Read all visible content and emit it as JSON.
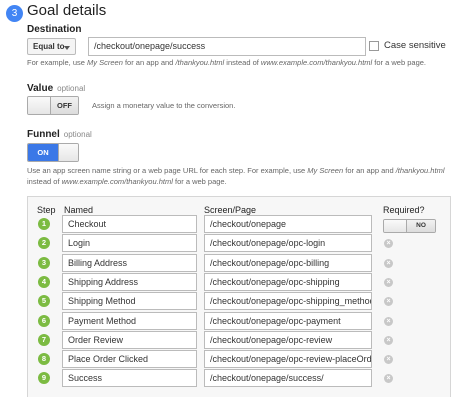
{
  "header": {
    "step_number": "3",
    "title": "Goal details"
  },
  "destination": {
    "label": "Destination",
    "match_type": "Equal to",
    "value": "/checkout/onepage/success",
    "case_sensitive_label": "Case sensitive",
    "help_parts": [
      "For example, use ",
      "My Screen",
      " for an app and ",
      "/thankyou.html",
      " instead of ",
      "www.example.com/thankyou.html",
      " for a web page."
    ]
  },
  "value": {
    "label": "Value",
    "optional": "optional",
    "toggle_state": "OFF",
    "help": "Assign a monetary value to the conversion."
  },
  "funnel": {
    "label": "Funnel",
    "optional": "optional",
    "toggle_state": "ON",
    "help_line1_parts": [
      "Use an app screen name string or a web page URL for each step. For example, use ",
      "My Screen",
      " for an app and ",
      "/thankyou.html"
    ],
    "help_line2_parts": [
      "instead of ",
      "www.example.com/thankyou.html",
      " for a web page."
    ],
    "columns": {
      "step": "Step",
      "named": "Named",
      "screen": "Screen/Page",
      "required": "Required?"
    },
    "required_toggle_state": "NO",
    "steps": [
      {
        "num": "1",
        "name": "Checkout",
        "screen": "/checkout/onepage"
      },
      {
        "num": "2",
        "name": "Login",
        "screen": "/checkout/onepage/opc-login"
      },
      {
        "num": "3",
        "name": "Billing Address",
        "screen": "/checkout/onepage/opc-billing"
      },
      {
        "num": "4",
        "name": "Shipping Address",
        "screen": "/checkout/onepage/opc-shipping"
      },
      {
        "num": "5",
        "name": "Shipping Method",
        "screen": "/checkout/onepage/opc-shipping_method"
      },
      {
        "num": "6",
        "name": "Payment Method",
        "screen": "/checkout/onepage/opc-payment"
      },
      {
        "num": "7",
        "name": "Order Review",
        "screen": "/checkout/onepage/opc-review"
      },
      {
        "num": "8",
        "name": "Place Order Clicked",
        "screen": "/checkout/onepage/opc-review-placeOrder"
      },
      {
        "num": "9",
        "name": "Success",
        "screen": "/checkout/onepage/success/"
      }
    ]
  }
}
